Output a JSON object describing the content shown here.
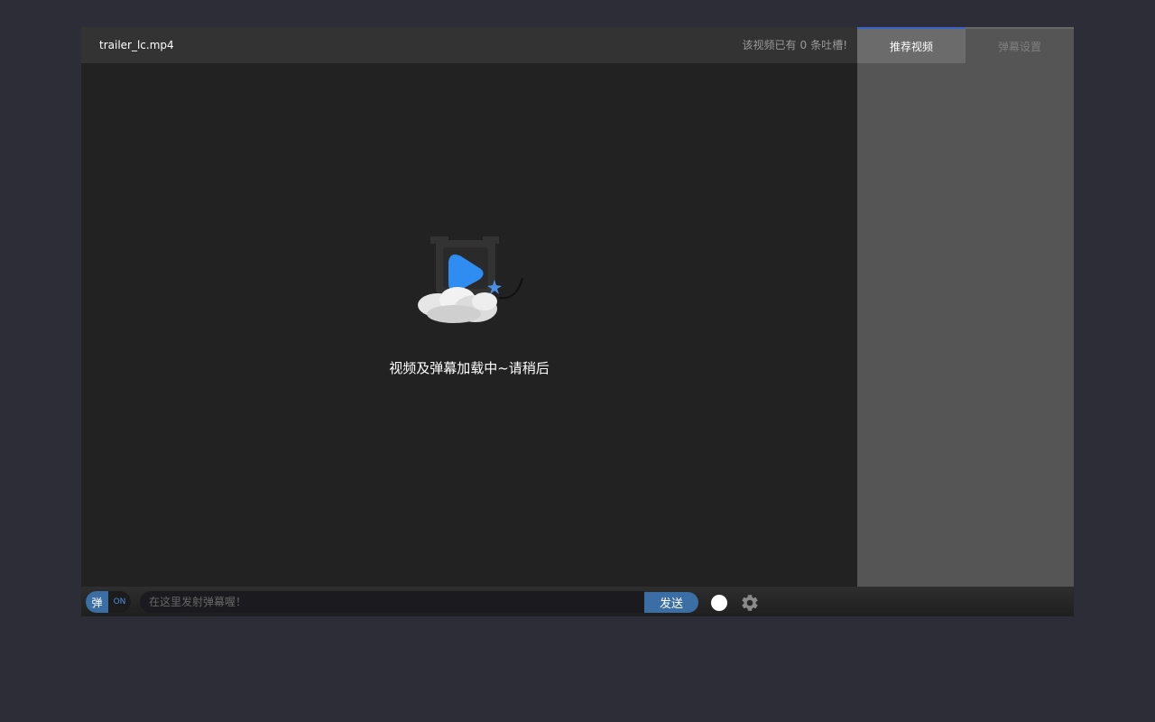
{
  "header": {
    "filename": "trailer_lc.mp4",
    "comment_prefix": "该视频已有",
    "comment_count": "0",
    "comment_suffix": "条吐槽!"
  },
  "player": {
    "loading_text": "视频及弹幕加载中~请稍后",
    "logo_icon": "cloud-play-logo-icon"
  },
  "side_panel": {
    "tabs": [
      {
        "label": "推荐视频",
        "active": true
      },
      {
        "label": "弹幕设置",
        "active": false
      }
    ]
  },
  "controls": {
    "toggle_char": "弹",
    "toggle_state": "ON",
    "input_placeholder": "在这里发射弹幕喔！",
    "input_value": "",
    "send_label": "发送",
    "color_value": "#ffffff",
    "settings_icon": "gear-icon"
  },
  "colors": {
    "accent": "#3a6ea5",
    "active_tab_border": "#3a62c7",
    "logo_blue": "#2f8cf0"
  }
}
